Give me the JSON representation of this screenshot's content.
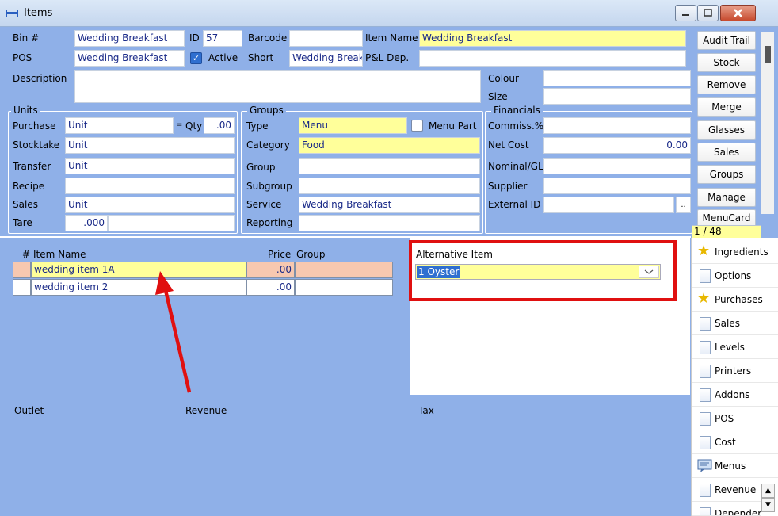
{
  "window": {
    "title": "Items"
  },
  "header": {
    "bin_label": "Bin #",
    "bin_value": "Wedding Breakfast",
    "id_label": "ID",
    "id_value": "57",
    "barcode_label": "Barcode",
    "barcode_value": "",
    "item_name_label": "Item Name",
    "item_name_value": "Wedding Breakfast",
    "pos_label": "POS",
    "pos_value": "Wedding Breakfast",
    "active_label": "Active",
    "short_label": "Short",
    "short_value": "Wedding Break",
    "pl_dep_label": "P&L Dep.",
    "pl_dep_value": "",
    "description_label": "Description",
    "description_value": "",
    "colour_label": "Colour",
    "colour_value": "",
    "size_label": "Size",
    "size_value": ""
  },
  "units": {
    "title": "Units",
    "purchase_label": "Purchase",
    "purchase_value": "Unit",
    "eq": "=",
    "qty_label": "Qty",
    "qty_value": ".00",
    "stocktake_label": "Stocktake",
    "stocktake_value": "Unit",
    "transfer_label": "Transfer",
    "transfer_value": "Unit",
    "recipe_label": "Recipe",
    "recipe_value": "",
    "sales_label": "Sales",
    "sales_value": "Unit",
    "tare_label": "Tare",
    "tare_value": ".000"
  },
  "groups": {
    "title": "Groups",
    "type_label": "Type",
    "type_value": "Menu",
    "menu_part_label": "Menu Part",
    "category_label": "Category",
    "category_value": "Food",
    "group_label": "Group",
    "group_value": "",
    "subgroup_label": "Subgroup",
    "subgroup_value": "",
    "service_label": "Service",
    "service_value": "Wedding Breakfast",
    "reporting_label": "Reporting",
    "reporting_value": ""
  },
  "financials": {
    "title": "Financials",
    "commiss_label": "Commiss.%",
    "commiss_value": "",
    "net_cost_label": "Net Cost",
    "net_cost_value": "0.00",
    "nominal_label": "Nominal/GL",
    "nominal_value": "",
    "supplier_label": "Supplier",
    "supplier_value": "",
    "external_label": "External ID",
    "external_value": "",
    "ellipsis": ".."
  },
  "right_buttons": [
    "Audit Trail",
    "Stock",
    "Remove",
    "Merge",
    "Glasses",
    "Sales",
    "Groups",
    "Manage",
    "MenuCard"
  ],
  "record_counter": "1 / 48",
  "items_grid": {
    "col_hash": "#",
    "col_name": "Item Name",
    "col_price": "Price",
    "col_group": "Group",
    "rows": [
      {
        "name": "wedding item 1A",
        "price": ".00",
        "group": ""
      },
      {
        "name": "wedding item 2",
        "price": ".00",
        "group": ""
      }
    ]
  },
  "alternative": {
    "label": "Alternative Item",
    "value": "1 Oyster"
  },
  "bottom_grid": {
    "col_outlet": "Outlet",
    "col_revenue": "Revenue",
    "col_tax": "Tax"
  },
  "tabs": [
    {
      "label": "Ingredients",
      "icon": "star-icon"
    },
    {
      "label": "Options",
      "icon": "page-icon"
    },
    {
      "label": "Purchases",
      "icon": "star-icon"
    },
    {
      "label": "Sales",
      "icon": "page-icon"
    },
    {
      "label": "Levels",
      "icon": "page-icon"
    },
    {
      "label": "Printers",
      "icon": "page-icon"
    },
    {
      "label": "Addons",
      "icon": "page-icon"
    },
    {
      "label": "POS",
      "icon": "page-icon"
    },
    {
      "label": "Cost",
      "icon": "page-icon"
    },
    {
      "label": "Menus",
      "icon": "menu-icon"
    },
    {
      "label": "Revenue",
      "icon": "page-icon"
    },
    {
      "label": "Depender",
      "icon": "page-icon"
    }
  ],
  "colors": {
    "field_highlight": "#ffff9a",
    "panel": "#8fb0e8",
    "arrow": "#e01010"
  }
}
